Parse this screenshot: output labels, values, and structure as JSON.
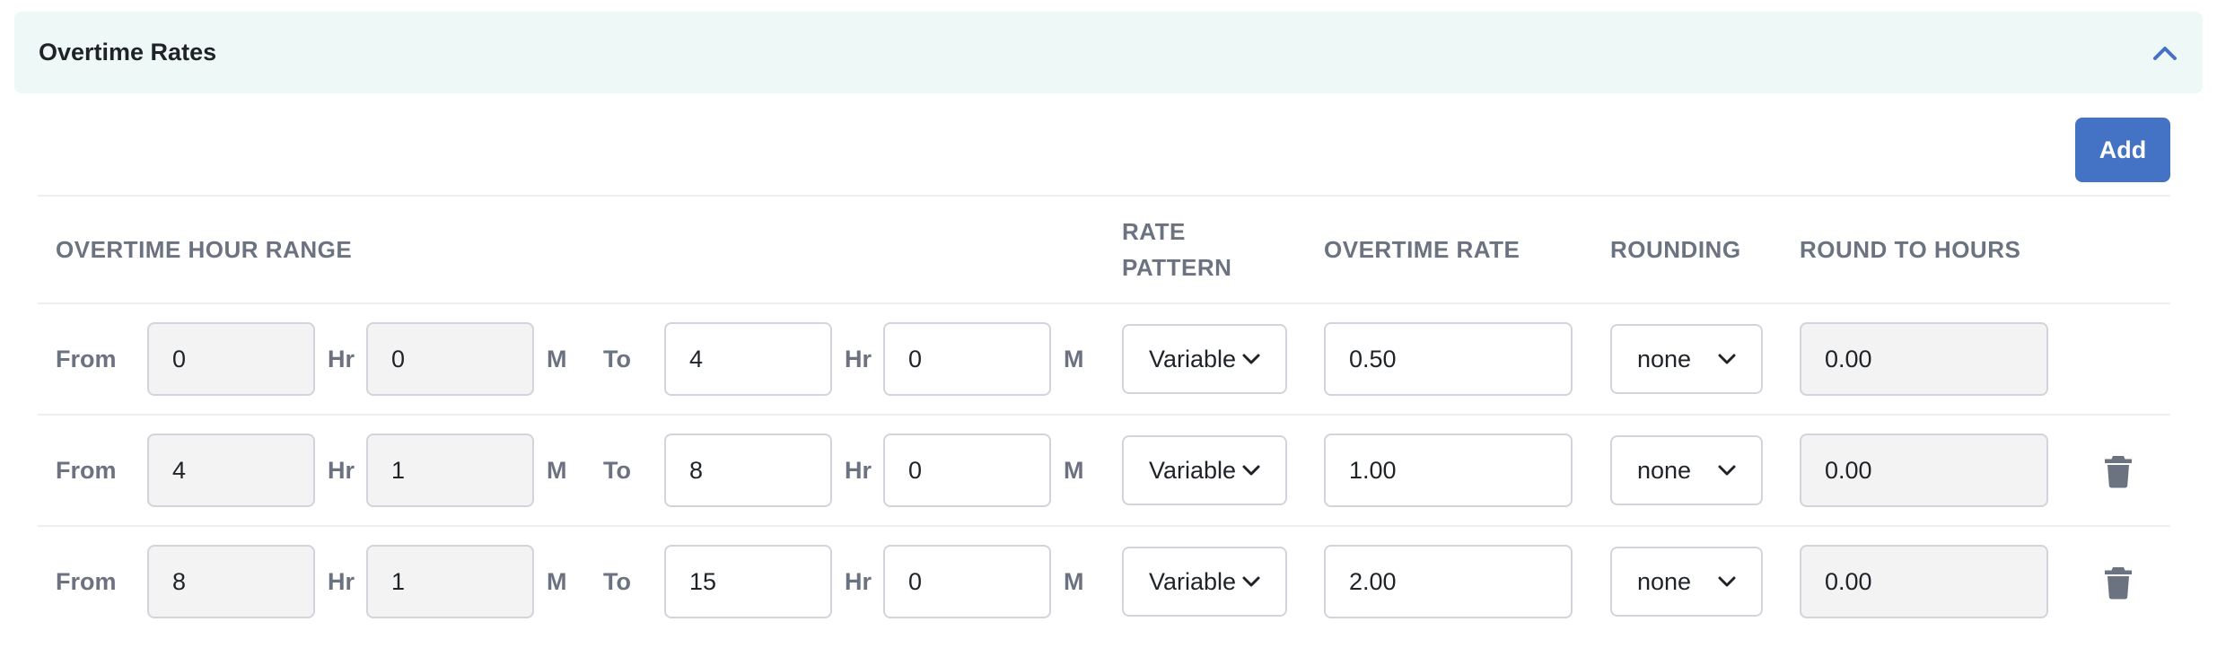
{
  "panel": {
    "title": "Overtime Rates"
  },
  "toolbar": {
    "add_label": "Add"
  },
  "columns": {
    "range": "OVERTIME HOUR RANGE",
    "pattern_line1": "RATE",
    "pattern_line2": "PATTERN",
    "rate": "OVERTIME RATE",
    "rounding": "ROUNDING",
    "round_to": "ROUND TO HOURS"
  },
  "labels": {
    "from": "From",
    "to": "To",
    "hr": "Hr",
    "m": "M"
  },
  "rows": [
    {
      "from_hr": "0",
      "from_m": "0",
      "to_hr": "4",
      "to_m": "0",
      "pattern": "Variable",
      "rate": "0.50",
      "rounding": "none",
      "round_to": "0.00",
      "deletable": false
    },
    {
      "from_hr": "4",
      "from_m": "1",
      "to_hr": "8",
      "to_m": "0",
      "pattern": "Variable",
      "rate": "1.00",
      "rounding": "none",
      "round_to": "0.00",
      "deletable": true
    },
    {
      "from_hr": "8",
      "from_m": "1",
      "to_hr": "15",
      "to_m": "0",
      "pattern": "Variable",
      "rate": "2.00",
      "rounding": "none",
      "round_to": "0.00",
      "deletable": true
    }
  ],
  "icons": {
    "collapse": "chevron-up-icon",
    "dropdown": "chevron-down-icon",
    "delete": "trash-icon"
  },
  "colors": {
    "header_bg": "#eef8f6",
    "accent": "#4472c4",
    "muted_text": "#6b7280",
    "readonly_bg": "#f3f3f3"
  }
}
